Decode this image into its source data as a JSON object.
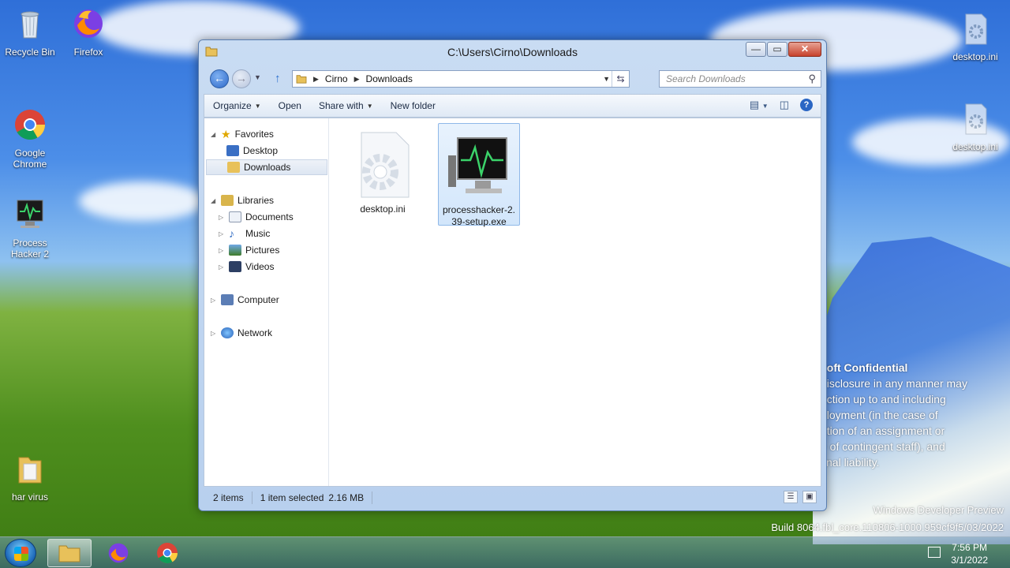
{
  "desktop": {
    "icons": [
      {
        "label": "Recycle Bin",
        "icon": "recycle-bin-icon"
      },
      {
        "label": "Firefox",
        "icon": "firefox-icon"
      },
      {
        "label": "Google\nChrome",
        "icon": "chrome-icon"
      },
      {
        "label": "Process\nHacker 2",
        "icon": "process-hacker-icon"
      },
      {
        "label": "har virus",
        "icon": "folder-icon"
      },
      {
        "label": "desktop.ini",
        "icon": "settings-file-icon"
      },
      {
        "label": "desktop.ini",
        "icon": "settings-file-icon"
      }
    ],
    "watermark": {
      "title": "soft Confidential",
      "lines": [
        "disclosure in any manner may",
        "action up to and including",
        "ployment (in the case of",
        "ation of an assignment or",
        "e of contingent staff), and",
        "cnal liability."
      ]
    },
    "build": {
      "line1": "Windows Developer Preview",
      "line2": "Build 8064.fbl_core.110806-1000.959cf9f5/03/2022"
    }
  },
  "window": {
    "title": "C:\\Users\\Cirno\\Downloads",
    "controls": {
      "minimize": "—",
      "maximize": "▭",
      "close": "✕"
    },
    "address": {
      "crumbs": [
        "Cirno",
        "Downloads"
      ]
    },
    "search": {
      "placeholder": "Search Downloads"
    },
    "toolbar": {
      "organize": "Organize",
      "open": "Open",
      "share_with": "Share with",
      "new_folder": "New folder",
      "help": "?"
    },
    "navpane": {
      "favorites": "Favorites",
      "desktop": "Desktop",
      "downloads": "Downloads",
      "libraries": "Libraries",
      "documents": "Documents",
      "music": "Music",
      "pictures": "Pictures",
      "videos": "Videos",
      "computer": "Computer",
      "network": "Network"
    },
    "files": [
      {
        "name": "desktop.ini",
        "selected": false
      },
      {
        "name": "processhacker-2.39-setup.exe",
        "selected": true
      }
    ],
    "status": {
      "count": "2 items",
      "selection": "1 item selected",
      "size": "2.16 MB"
    }
  },
  "taskbar": {
    "time": "7:56 PM",
    "date": "3/1/2022"
  },
  "colors": {
    "accent": "#2d69c9",
    "selection": "#d2e6fb",
    "close": "#c7422c"
  }
}
